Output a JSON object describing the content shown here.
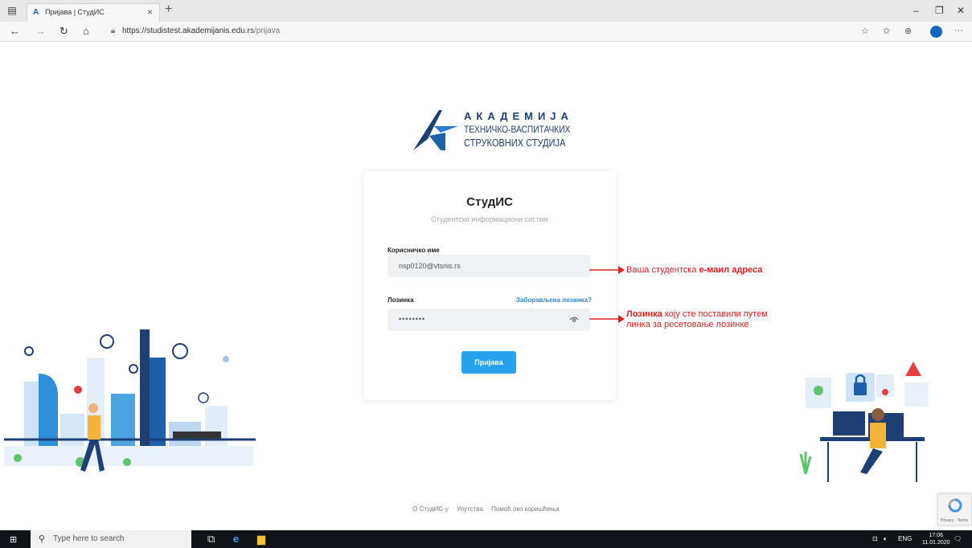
{
  "browser": {
    "tab_title": "Пријава | СтудИС",
    "url_host": "https://studistest.akademijanis.edu.rs",
    "url_path": "/prijava"
  },
  "logo": {
    "line1": "АКАДЕМИЈА",
    "line2": "ТЕХНИЧКО-ВАСПИТАЧКИХ",
    "line3": "СТРУКОВНИХ СТУДИЈА"
  },
  "login": {
    "title": "СтудИС",
    "subtitle": "Студентски информациони систем",
    "username_label": "Корисничко име",
    "username_value": "nsp0120@vtsnis.rs",
    "password_label": "Лозинка",
    "forgot_label": "Заборављена лозинка?",
    "password_value": "••••••••",
    "submit_label": "Пријава"
  },
  "annotations": {
    "email_prefix": "Ваша студентска ",
    "email_bold": "е-маил адреса",
    "password_bold": "Лозинка",
    "password_rest": " коју сте поставили путем",
    "password_line2": "линка за ресетовање лозинке"
  },
  "footer": {
    "about": "О СтудИС-у",
    "instructions": "Упутства",
    "help": "Помоћ око коришћења"
  },
  "recaptcha": {
    "text": "Privacy - Terms"
  },
  "taskbar": {
    "search_placeholder": "Type here to search",
    "lang": "ENG",
    "time": "17:06",
    "date": "11.01.2020"
  },
  "colors": {
    "accent": "#27a3ee",
    "annotation": "#e02020",
    "logo_blue": "#1d3f74"
  }
}
